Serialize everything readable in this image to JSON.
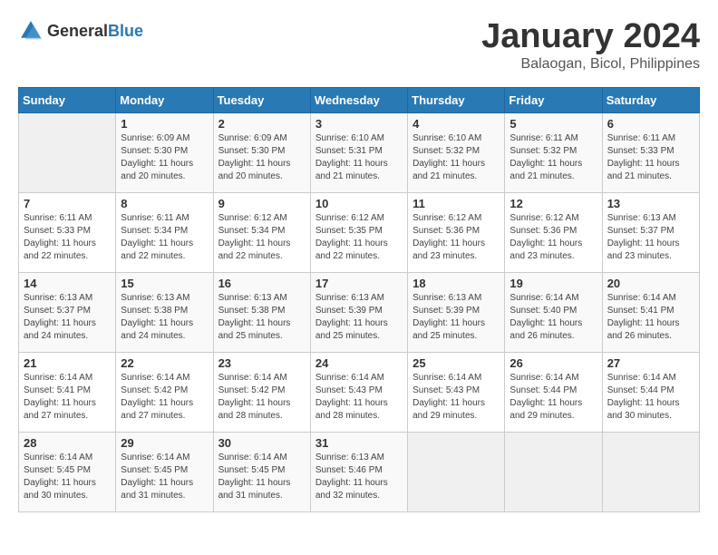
{
  "header": {
    "logo_general": "General",
    "logo_blue": "Blue",
    "title": "January 2024",
    "subtitle": "Balaogan, Bicol, Philippines"
  },
  "weekdays": [
    "Sunday",
    "Monday",
    "Tuesday",
    "Wednesday",
    "Thursday",
    "Friday",
    "Saturday"
  ],
  "weeks": [
    [
      {
        "day": "",
        "sunrise": "",
        "sunset": "",
        "daylight": "",
        "empty": true
      },
      {
        "day": "1",
        "sunrise": "Sunrise: 6:09 AM",
        "sunset": "Sunset: 5:30 PM",
        "daylight": "Daylight: 11 hours and 20 minutes."
      },
      {
        "day": "2",
        "sunrise": "Sunrise: 6:09 AM",
        "sunset": "Sunset: 5:30 PM",
        "daylight": "Daylight: 11 hours and 20 minutes."
      },
      {
        "day": "3",
        "sunrise": "Sunrise: 6:10 AM",
        "sunset": "Sunset: 5:31 PM",
        "daylight": "Daylight: 11 hours and 21 minutes."
      },
      {
        "day": "4",
        "sunrise": "Sunrise: 6:10 AM",
        "sunset": "Sunset: 5:32 PM",
        "daylight": "Daylight: 11 hours and 21 minutes."
      },
      {
        "day": "5",
        "sunrise": "Sunrise: 6:11 AM",
        "sunset": "Sunset: 5:32 PM",
        "daylight": "Daylight: 11 hours and 21 minutes."
      },
      {
        "day": "6",
        "sunrise": "Sunrise: 6:11 AM",
        "sunset": "Sunset: 5:33 PM",
        "daylight": "Daylight: 11 hours and 21 minutes."
      }
    ],
    [
      {
        "day": "7",
        "sunrise": "Sunrise: 6:11 AM",
        "sunset": "Sunset: 5:33 PM",
        "daylight": "Daylight: 11 hours and 22 minutes."
      },
      {
        "day": "8",
        "sunrise": "Sunrise: 6:11 AM",
        "sunset": "Sunset: 5:34 PM",
        "daylight": "Daylight: 11 hours and 22 minutes."
      },
      {
        "day": "9",
        "sunrise": "Sunrise: 6:12 AM",
        "sunset": "Sunset: 5:34 PM",
        "daylight": "Daylight: 11 hours and 22 minutes."
      },
      {
        "day": "10",
        "sunrise": "Sunrise: 6:12 AM",
        "sunset": "Sunset: 5:35 PM",
        "daylight": "Daylight: 11 hours and 22 minutes."
      },
      {
        "day": "11",
        "sunrise": "Sunrise: 6:12 AM",
        "sunset": "Sunset: 5:36 PM",
        "daylight": "Daylight: 11 hours and 23 minutes."
      },
      {
        "day": "12",
        "sunrise": "Sunrise: 6:12 AM",
        "sunset": "Sunset: 5:36 PM",
        "daylight": "Daylight: 11 hours and 23 minutes."
      },
      {
        "day": "13",
        "sunrise": "Sunrise: 6:13 AM",
        "sunset": "Sunset: 5:37 PM",
        "daylight": "Daylight: 11 hours and 23 minutes."
      }
    ],
    [
      {
        "day": "14",
        "sunrise": "Sunrise: 6:13 AM",
        "sunset": "Sunset: 5:37 PM",
        "daylight": "Daylight: 11 hours and 24 minutes."
      },
      {
        "day": "15",
        "sunrise": "Sunrise: 6:13 AM",
        "sunset": "Sunset: 5:38 PM",
        "daylight": "Daylight: 11 hours and 24 minutes."
      },
      {
        "day": "16",
        "sunrise": "Sunrise: 6:13 AM",
        "sunset": "Sunset: 5:38 PM",
        "daylight": "Daylight: 11 hours and 25 minutes."
      },
      {
        "day": "17",
        "sunrise": "Sunrise: 6:13 AM",
        "sunset": "Sunset: 5:39 PM",
        "daylight": "Daylight: 11 hours and 25 minutes."
      },
      {
        "day": "18",
        "sunrise": "Sunrise: 6:13 AM",
        "sunset": "Sunset: 5:39 PM",
        "daylight": "Daylight: 11 hours and 25 minutes."
      },
      {
        "day": "19",
        "sunrise": "Sunrise: 6:14 AM",
        "sunset": "Sunset: 5:40 PM",
        "daylight": "Daylight: 11 hours and 26 minutes."
      },
      {
        "day": "20",
        "sunrise": "Sunrise: 6:14 AM",
        "sunset": "Sunset: 5:41 PM",
        "daylight": "Daylight: 11 hours and 26 minutes."
      }
    ],
    [
      {
        "day": "21",
        "sunrise": "Sunrise: 6:14 AM",
        "sunset": "Sunset: 5:41 PM",
        "daylight": "Daylight: 11 hours and 27 minutes."
      },
      {
        "day": "22",
        "sunrise": "Sunrise: 6:14 AM",
        "sunset": "Sunset: 5:42 PM",
        "daylight": "Daylight: 11 hours and 27 minutes."
      },
      {
        "day": "23",
        "sunrise": "Sunrise: 6:14 AM",
        "sunset": "Sunset: 5:42 PM",
        "daylight": "Daylight: 11 hours and 28 minutes."
      },
      {
        "day": "24",
        "sunrise": "Sunrise: 6:14 AM",
        "sunset": "Sunset: 5:43 PM",
        "daylight": "Daylight: 11 hours and 28 minutes."
      },
      {
        "day": "25",
        "sunrise": "Sunrise: 6:14 AM",
        "sunset": "Sunset: 5:43 PM",
        "daylight": "Daylight: 11 hours and 29 minutes."
      },
      {
        "day": "26",
        "sunrise": "Sunrise: 6:14 AM",
        "sunset": "Sunset: 5:44 PM",
        "daylight": "Daylight: 11 hours and 29 minutes."
      },
      {
        "day": "27",
        "sunrise": "Sunrise: 6:14 AM",
        "sunset": "Sunset: 5:44 PM",
        "daylight": "Daylight: 11 hours and 30 minutes."
      }
    ],
    [
      {
        "day": "28",
        "sunrise": "Sunrise: 6:14 AM",
        "sunset": "Sunset: 5:45 PM",
        "daylight": "Daylight: 11 hours and 30 minutes."
      },
      {
        "day": "29",
        "sunrise": "Sunrise: 6:14 AM",
        "sunset": "Sunset: 5:45 PM",
        "daylight": "Daylight: 11 hours and 31 minutes."
      },
      {
        "day": "30",
        "sunrise": "Sunrise: 6:14 AM",
        "sunset": "Sunset: 5:45 PM",
        "daylight": "Daylight: 11 hours and 31 minutes."
      },
      {
        "day": "31",
        "sunrise": "Sunrise: 6:13 AM",
        "sunset": "Sunset: 5:46 PM",
        "daylight": "Daylight: 11 hours and 32 minutes."
      },
      {
        "day": "",
        "sunrise": "",
        "sunset": "",
        "daylight": "",
        "empty": true
      },
      {
        "day": "",
        "sunrise": "",
        "sunset": "",
        "daylight": "",
        "empty": true
      },
      {
        "day": "",
        "sunrise": "",
        "sunset": "",
        "daylight": "",
        "empty": true
      }
    ]
  ]
}
